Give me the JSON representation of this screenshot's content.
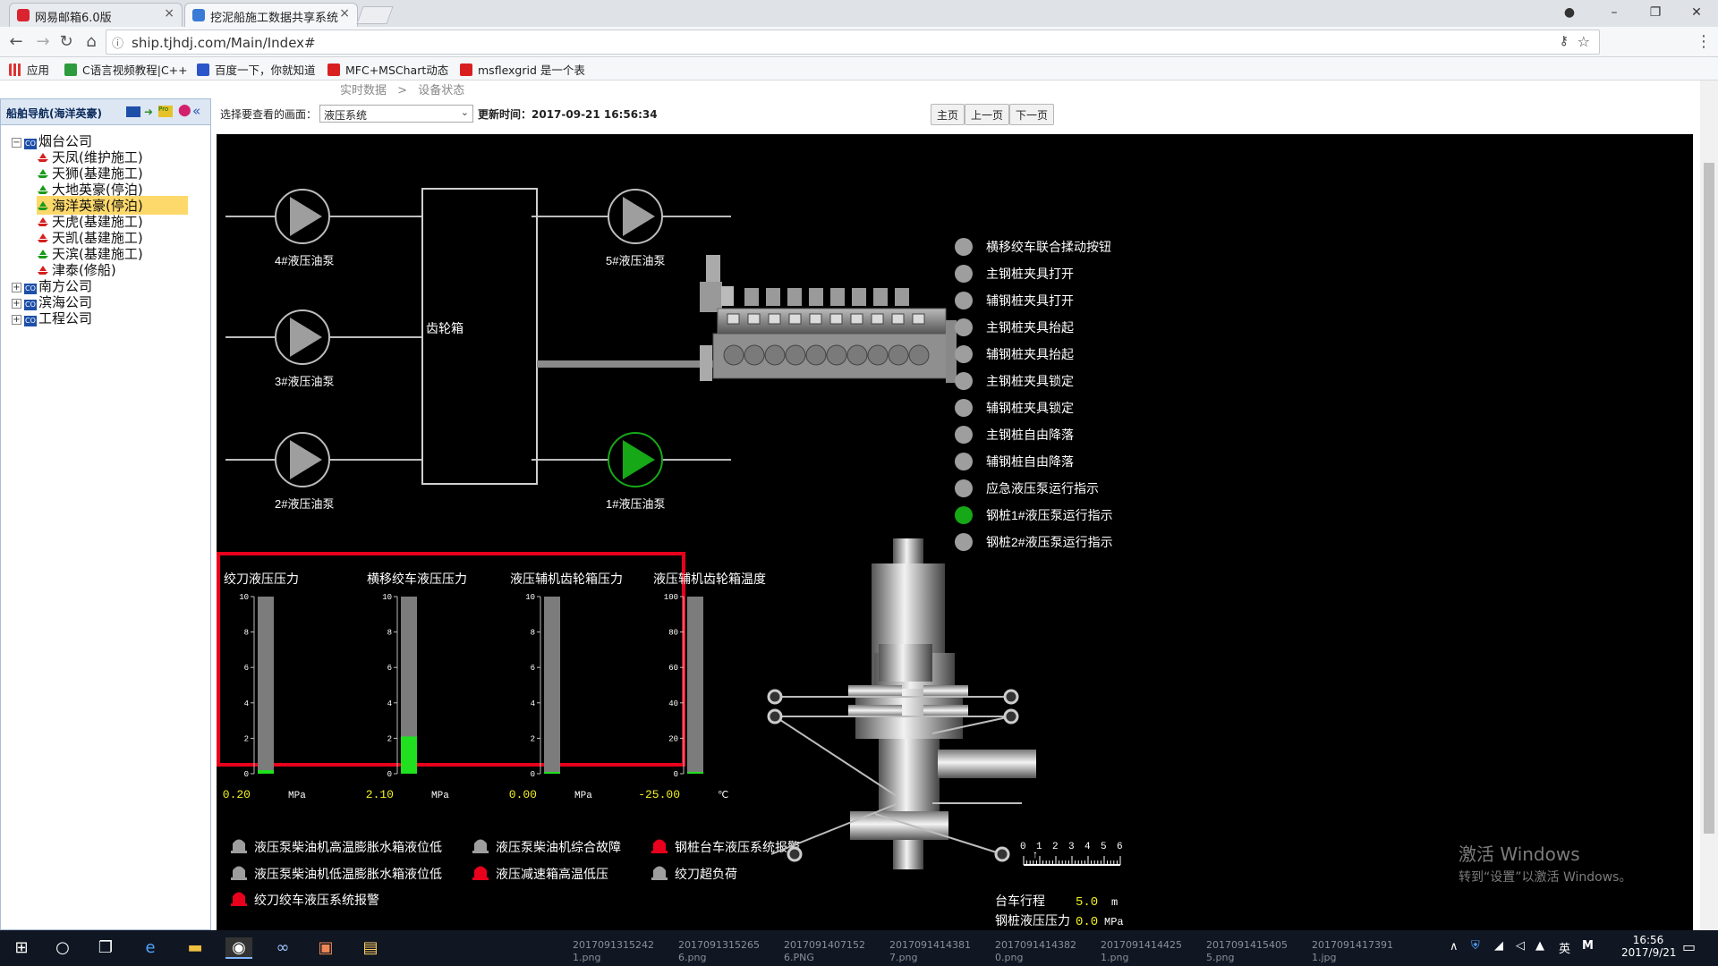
{
  "browser": {
    "tabs": [
      {
        "label": "网易邮箱6.0版",
        "active": false
      },
      {
        "label": "挖泥船施工数据共享系统",
        "active": true
      }
    ],
    "url": "ship.tjhdj.com/Main/Index#",
    "bookmarks": [
      "应用",
      "C语言视频教程|C++",
      "百度一下，你就知道",
      "MFC+MSChart动态",
      "msflexgrid 是一个表"
    ]
  },
  "breadcrumb": {
    "items": [
      "实时数据",
      ">",
      "设备状态"
    ]
  },
  "sidebar": {
    "title": "船舶导航(海洋英豪)",
    "tree": [
      {
        "label": "烟台公司",
        "expanded": true,
        "children": [
          {
            "label": "天凤(维护施工)",
            "status": "red"
          },
          {
            "label": "天狮(基建施工)",
            "status": "green"
          },
          {
            "label": "大地英豪(停泊)",
            "status": "green"
          },
          {
            "label": "海洋英豪(停泊)",
            "status": "green",
            "selected": true
          },
          {
            "label": "天虎(基建施工)",
            "status": "red"
          },
          {
            "label": "天凯(基建施工)",
            "status": "red"
          },
          {
            "label": "天滨(基建施工)",
            "status": "green"
          },
          {
            "label": "津泰(修船)",
            "status": "red"
          }
        ]
      },
      {
        "label": "南方公司",
        "expanded": false,
        "children": []
      },
      {
        "label": "滨海公司",
        "expanded": false,
        "children": []
      },
      {
        "label": "工程公司",
        "expanded": false,
        "children": []
      }
    ]
  },
  "toolbar": {
    "select_label": "选择要查看的画面：",
    "select_value": "液压系统",
    "update_label": "更新时间：2017-09-21 16:56:34",
    "buttons": [
      "主页",
      "上一页",
      "下一页"
    ]
  },
  "scada": {
    "gearbox_label": "齿轮箱",
    "pumps": [
      {
        "label": "4#液压油泵",
        "running": false
      },
      {
        "label": "3#液压油泵",
        "running": false
      },
      {
        "label": "2#液压油泵",
        "running": false
      },
      {
        "label": "5#液压油泵",
        "running": false
      },
      {
        "label": "1#液压油泵",
        "running": true
      }
    ],
    "indicators": [
      {
        "label": "横移绞车联合揉动按钮",
        "on": false
      },
      {
        "label": "主钢桩夹具打开",
        "on": false
      },
      {
        "label": "辅钢桩夹具打开",
        "on": false
      },
      {
        "label": "主钢桩夹具抬起",
        "on": false
      },
      {
        "label": "辅钢桩夹具抬起",
        "on": false
      },
      {
        "label": "主钢桩夹具锁定",
        "on": false
      },
      {
        "label": "辅钢桩夹具锁定",
        "on": false
      },
      {
        "label": "主钢桩自由降落",
        "on": false
      },
      {
        "label": "辅钢桩自由降落",
        "on": false
      },
      {
        "label": "应急液压泵运行指示",
        "on": false
      },
      {
        "label": "钢桩1#液压泵运行指示",
        "on": true
      },
      {
        "label": "钢桩2#液压泵运行指示",
        "on": false
      }
    ],
    "gauges": [
      {
        "title": "绞刀液压压力",
        "value": 0.2,
        "value_text": "0.20",
        "unit": "MPa",
        "max": 10,
        "ticks": [
          "10",
          "8",
          "6",
          "4",
          "2",
          "0"
        ]
      },
      {
        "title": "横移绞车液压压力",
        "value": 2.1,
        "value_text": "2.10",
        "unit": "MPa",
        "max": 10,
        "ticks": [
          "10",
          "8",
          "6",
          "4",
          "2",
          "0"
        ]
      },
      {
        "title": "液压辅机齿轮箱压力",
        "value": 0.0,
        "value_text": "0.00",
        "unit": "MPa",
        "max": 10,
        "ticks": [
          "10",
          "8",
          "6",
          "4",
          "2",
          "0"
        ]
      },
      {
        "title": "液压辅机齿轮箱温度",
        "value": -25.0,
        "value_text": "-25.00",
        "unit": "℃",
        "max": 100,
        "ticks": [
          "100",
          "80",
          "60",
          "40",
          "20",
          "0"
        ]
      }
    ],
    "alarms": [
      {
        "label": "液压泵柴油机高温膨胀水箱液位低",
        "active": false
      },
      {
        "label": "液压泵柴油机综合故障",
        "active": false
      },
      {
        "label": "钢桩台车液压系统报警",
        "active": true
      },
      {
        "label": "液压泵柴油机低温膨胀水箱液位低",
        "active": false
      },
      {
        "label": "液压减速箱高温低压",
        "active": true
      },
      {
        "label": "绞刀超负荷",
        "active": false
      },
      {
        "label": "绞刀绞车液压系统报警",
        "active": true
      }
    ],
    "carriage": {
      "scale_ticks": [
        "0",
        "1",
        "2",
        "3",
        "4",
        "5",
        "6"
      ],
      "travel_label": "台车行程",
      "travel_value": "5.0",
      "travel_unit": "m",
      "pressure_label": "钢桩液压压力",
      "pressure_value": "0.0",
      "pressure_unit": "MPa"
    }
  },
  "windows_watermark": {
    "line1": "激活 Windows",
    "line2": "转到“设置”以激活 Windows。"
  },
  "taskbar": {
    "files": [
      {
        "l1": "2017091315242",
        "l2": "1.png"
      },
      {
        "l1": "2017091315265",
        "l2": "6.png"
      },
      {
        "l1": "2017091407152",
        "l2": "6.PNG"
      },
      {
        "l1": "2017091414381",
        "l2": "7.png"
      },
      {
        "l1": "2017091414382",
        "l2": "0.png"
      },
      {
        "l1": "2017091414425",
        "l2": "1.png"
      },
      {
        "l1": "2017091415405",
        "l2": "5.png"
      },
      {
        "l1": "2017091417391",
        "l2": "1.jpg"
      }
    ],
    "ime": "英",
    "time": "16:56",
    "date": "2017/9/21"
  },
  "colors": {
    "accent_red": "#e8001c",
    "run_green": "#17a817",
    "gauge_green": "#20e020",
    "value_yellow": "#f0f020"
  }
}
